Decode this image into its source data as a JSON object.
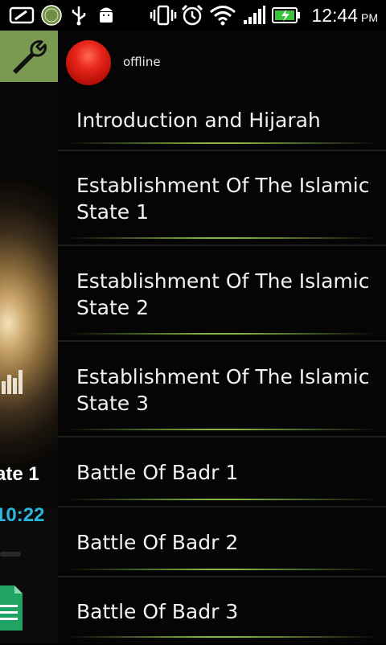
{
  "status_bar": {
    "time": "12:44",
    "ampm": "PM",
    "icons": [
      "screen-capture-icon",
      "quran-app-icon",
      "usb-icon",
      "android-debug-icon",
      "vibrate-icon",
      "alarm-icon",
      "wifi-icon",
      "signal-icon",
      "battery-charging-icon"
    ]
  },
  "left_panel": {
    "title_fragment": "ate 1",
    "time": "10:22"
  },
  "connection": {
    "status": "offline",
    "color": "#e8261a"
  },
  "playlist": {
    "items": [
      {
        "label": "Introduction and Hijarah"
      },
      {
        "label": "Establishment Of The Islamic State 1"
      },
      {
        "label": "Establishment Of The Islamic State 2"
      },
      {
        "label": "Establishment Of The Islamic State 3"
      },
      {
        "label": "Battle Of Badr 1"
      },
      {
        "label": "Battle Of Badr 2"
      },
      {
        "label": "Battle Of Badr 3"
      }
    ]
  },
  "colors": {
    "accent_green": "#7a9a52",
    "time_blue": "#2bb6e0"
  }
}
